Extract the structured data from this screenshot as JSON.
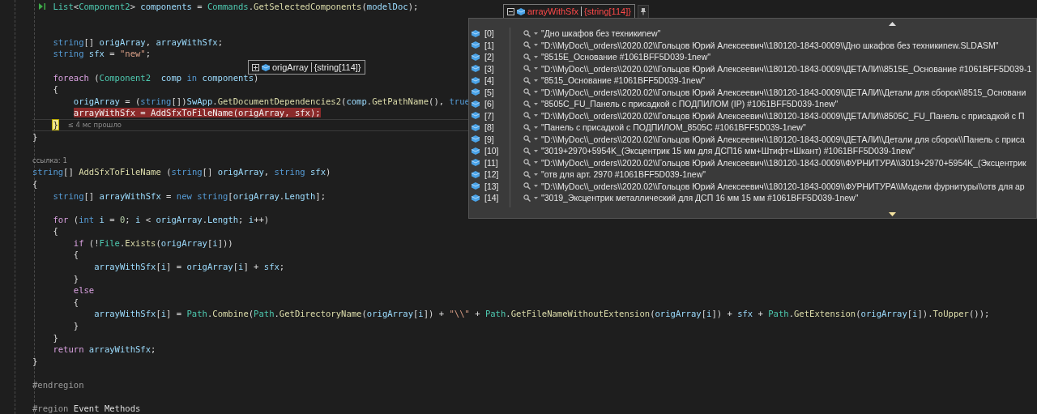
{
  "editor": {
    "lines": [
      {
        "kind": "block",
        "children": [
          {
            "kind": "code",
            "gutter_icon": true,
            "tokens": [
              {
                "text": "List",
                "kind": "type"
              },
              {
                "text": "<",
                "kind": "pl"
              },
              {
                "text": "Component2",
                "kind": "type"
              },
              {
                "text": "> ",
                "kind": "pl"
              },
              {
                "text": "components",
                "kind": "var"
              },
              {
                "text": " = ",
                "kind": "pl"
              },
              {
                "text": "Commands",
                "kind": "type"
              },
              {
                "text": ".",
                "kind": "pl"
              },
              {
                "text": "GetSelectedComponents",
                "kind": "fn"
              },
              {
                "text": "(",
                "kind": "pl"
              },
              {
                "text": "modelDoc",
                "kind": "var"
              },
              {
                "text": ");",
                "kind": "pl"
              }
            ]
          },
          {
            "kind": "blank"
          },
          {
            "kind": "blank"
          },
          {
            "kind": "code",
            "tokens": [
              {
                "text": "string",
                "kind": "kw"
              },
              {
                "text": "[] ",
                "kind": "pl"
              },
              {
                "text": "origArray",
                "kind": "var"
              },
              {
                "text": ", ",
                "kind": "pl"
              },
              {
                "text": "arrayWithSfx",
                "kind": "var"
              },
              {
                "text": ";",
                "kind": "pl"
              }
            ]
          },
          {
            "kind": "code",
            "tokens": [
              {
                "text": "string",
                "kind": "kw"
              },
              {
                "text": " sfx",
                "kind": "var"
              },
              {
                "text": " = ",
                "kind": "pl"
              },
              {
                "text": "\"new\"",
                "kind": "str"
              },
              {
                "text": ";",
                "kind": "pl"
              }
            ]
          },
          {
            "kind": "blank"
          },
          {
            "kind": "code",
            "tokens": [
              {
                "text": "foreach",
                "kind": "ctl"
              },
              {
                "text": " (",
                "kind": "pl"
              },
              {
                "text": "Component2",
                "kind": "type"
              },
              {
                "text": "  comp",
                "kind": "var"
              },
              {
                "text": " in ",
                "kind": "kw"
              },
              {
                "text": "components",
                "kind": "var"
              },
              {
                "text": ")",
                "kind": "pl"
              }
            ]
          },
          {
            "kind": "code",
            "tokens": [
              {
                "text": "{",
                "kind": "pl"
              }
            ],
            "children": [
              {
                "kind": "code",
                "tokens": [
                  {
                    "text": "origArray",
                    "kind": "var"
                  },
                  {
                    "text": " = (",
                    "kind": "pl"
                  },
                  {
                    "text": "string",
                    "kind": "kw"
                  },
                  {
                    "text": "[])",
                    "kind": "pl"
                  },
                  {
                    "text": "SwApp",
                    "kind": "var"
                  },
                  {
                    "text": ".",
                    "kind": "pl"
                  },
                  {
                    "text": "GetDocumentDependencies2",
                    "kind": "fn"
                  },
                  {
                    "text": "(",
                    "kind": "pl"
                  },
                  {
                    "text": "comp",
                    "kind": "var"
                  },
                  {
                    "text": ".",
                    "kind": "pl"
                  },
                  {
                    "text": "GetPathName",
                    "kind": "fn"
                  },
                  {
                    "text": "(), ",
                    "kind": "pl"
                  },
                  {
                    "text": "true",
                    "kind": "kw"
                  }
                ]
              },
              {
                "kind": "breakpoint",
                "tokens": [
                  {
                    "text": "arrayWithSfx",
                    "kind": "var"
                  },
                  {
                    "text": " = ",
                    "kind": "pl"
                  },
                  {
                    "text": "AddSfxToFileName",
                    "kind": "fn"
                  },
                  {
                    "text": "(",
                    "kind": "pl"
                  },
                  {
                    "text": "origArray",
                    "kind": "var"
                  },
                  {
                    "text": ", ",
                    "kind": "pl"
                  },
                  {
                    "text": "sfx",
                    "kind": "var"
                  },
                  {
                    "text": ");",
                    "kind": "pl"
                  }
                ]
              }
            ]
          },
          {
            "kind": "current",
            "perf_tip": "≤ 4 мс прошло",
            "tokens": [
              {
                "text": "}",
                "kind": "pl"
              }
            ]
          }
        ]
      },
      {
        "kind": "code",
        "tokens": [
          {
            "text": "}",
            "kind": "pl"
          }
        ]
      },
      {
        "kind": "blank"
      },
      {
        "kind": "lens",
        "tokens": [
          {
            "text": "ссылка: 1",
            "kind": "lens"
          }
        ]
      },
      {
        "kind": "code",
        "tokens": [
          {
            "text": "string",
            "kind": "kw"
          },
          {
            "text": "[] ",
            "kind": "pl"
          },
          {
            "text": "AddSfxToFileName",
            "kind": "fn"
          },
          {
            "text": " (",
            "kind": "pl"
          },
          {
            "text": "string",
            "kind": "kw"
          },
          {
            "text": "[] ",
            "kind": "pl"
          },
          {
            "text": "origArray",
            "kind": "var"
          },
          {
            "text": ", ",
            "kind": "pl"
          },
          {
            "text": "string",
            "kind": "kw"
          },
          {
            "text": " sfx",
            "kind": "var"
          },
          {
            "text": ")",
            "kind": "pl"
          }
        ]
      },
      {
        "kind": "code",
        "tokens": [
          {
            "text": "{",
            "kind": "pl"
          }
        ],
        "children": [
          {
            "kind": "code",
            "tokens": [
              {
                "text": "string",
                "kind": "kw"
              },
              {
                "text": "[] ",
                "kind": "pl"
              },
              {
                "text": "arrayWithSfx",
                "kind": "var"
              },
              {
                "text": " = ",
                "kind": "pl"
              },
              {
                "text": "new",
                "kind": "kw"
              },
              {
                "text": " string",
                "kind": "kw"
              },
              {
                "text": "[",
                "kind": "pl"
              },
              {
                "text": "origArray",
                "kind": "var"
              },
              {
                "text": ".",
                "kind": "pl"
              },
              {
                "text": "Length",
                "kind": "var"
              },
              {
                "text": "];",
                "kind": "pl"
              }
            ]
          },
          {
            "kind": "blank"
          },
          {
            "kind": "code",
            "tokens": [
              {
                "text": "for",
                "kind": "ctl"
              },
              {
                "text": " (",
                "kind": "pl"
              },
              {
                "text": "int",
                "kind": "kw"
              },
              {
                "text": " i",
                "kind": "var"
              },
              {
                "text": " = ",
                "kind": "pl"
              },
              {
                "text": "0",
                "kind": "num"
              },
              {
                "text": "; ",
                "kind": "pl"
              },
              {
                "text": "i",
                "kind": "var"
              },
              {
                "text": " < ",
                "kind": "pl"
              },
              {
                "text": "origArray",
                "kind": "var"
              },
              {
                "text": ".",
                "kind": "pl"
              },
              {
                "text": "Length",
                "kind": "var"
              },
              {
                "text": "; ",
                "kind": "pl"
              },
              {
                "text": "i",
                "kind": "var"
              },
              {
                "text": "++)",
                "kind": "pl"
              }
            ]
          },
          {
            "kind": "code",
            "tokens": [
              {
                "text": "{",
                "kind": "pl"
              }
            ],
            "children": [
              {
                "kind": "code",
                "tokens": [
                  {
                    "text": "if",
                    "kind": "ctl"
                  },
                  {
                    "text": " (!",
                    "kind": "pl"
                  },
                  {
                    "text": "File",
                    "kind": "type"
                  },
                  {
                    "text": ".",
                    "kind": "pl"
                  },
                  {
                    "text": "Exists",
                    "kind": "fn"
                  },
                  {
                    "text": "(",
                    "kind": "pl"
                  },
                  {
                    "text": "origArray",
                    "kind": "var"
                  },
                  {
                    "text": "[",
                    "kind": "pl"
                  },
                  {
                    "text": "i",
                    "kind": "var"
                  },
                  {
                    "text": "]))",
                    "kind": "pl"
                  }
                ]
              },
              {
                "kind": "code",
                "tokens": [
                  {
                    "text": "{",
                    "kind": "pl"
                  }
                ],
                "children": [
                  {
                    "kind": "code",
                    "tokens": [
                      {
                        "text": "arrayWithSfx",
                        "kind": "var"
                      },
                      {
                        "text": "[",
                        "kind": "pl"
                      },
                      {
                        "text": "i",
                        "kind": "var"
                      },
                      {
                        "text": "] = ",
                        "kind": "pl"
                      },
                      {
                        "text": "origArray",
                        "kind": "var"
                      },
                      {
                        "text": "[",
                        "kind": "pl"
                      },
                      {
                        "text": "i",
                        "kind": "var"
                      },
                      {
                        "text": "] + ",
                        "kind": "pl"
                      },
                      {
                        "text": "sfx",
                        "kind": "var"
                      },
                      {
                        "text": ";",
                        "kind": "pl"
                      }
                    ]
                  }
                ]
              },
              {
                "kind": "code",
                "tokens": [
                  {
                    "text": "}",
                    "kind": "pl"
                  }
                ]
              },
              {
                "kind": "code",
                "tokens": [
                  {
                    "text": "else",
                    "kind": "ctl"
                  }
                ]
              },
              {
                "kind": "code",
                "tokens": [
                  {
                    "text": "{",
                    "kind": "pl"
                  }
                ],
                "children": [
                  {
                    "kind": "code",
                    "tokens": [
                      {
                        "text": "arrayWithSfx",
                        "kind": "var"
                      },
                      {
                        "text": "[",
                        "kind": "pl"
                      },
                      {
                        "text": "i",
                        "kind": "var"
                      },
                      {
                        "text": "] = ",
                        "kind": "pl"
                      },
                      {
                        "text": "Path",
                        "kind": "type"
                      },
                      {
                        "text": ".",
                        "kind": "pl"
                      },
                      {
                        "text": "Combine",
                        "kind": "fn"
                      },
                      {
                        "text": "(",
                        "kind": "pl"
                      },
                      {
                        "text": "Path",
                        "kind": "type"
                      },
                      {
                        "text": ".",
                        "kind": "pl"
                      },
                      {
                        "text": "GetDirectoryName",
                        "kind": "fn"
                      },
                      {
                        "text": "(",
                        "kind": "pl"
                      },
                      {
                        "text": "origArray",
                        "kind": "var"
                      },
                      {
                        "text": "[",
                        "kind": "pl"
                      },
                      {
                        "text": "i",
                        "kind": "var"
                      },
                      {
                        "text": "]) + ",
                        "kind": "pl"
                      },
                      {
                        "text": "\"\\\\\"",
                        "kind": "str"
                      },
                      {
                        "text": " + ",
                        "kind": "pl"
                      },
                      {
                        "text": "Path",
                        "kind": "type"
                      },
                      {
                        "text": ".",
                        "kind": "pl"
                      },
                      {
                        "text": "GetFileNameWithoutExtension",
                        "kind": "fn"
                      },
                      {
                        "text": "(",
                        "kind": "pl"
                      },
                      {
                        "text": "origArray",
                        "kind": "var"
                      },
                      {
                        "text": "[",
                        "kind": "pl"
                      },
                      {
                        "text": "i",
                        "kind": "var"
                      },
                      {
                        "text": "]) + ",
                        "kind": "pl"
                      },
                      {
                        "text": "sfx",
                        "kind": "var"
                      },
                      {
                        "text": " + ",
                        "kind": "pl"
                      },
                      {
                        "text": "Path",
                        "kind": "type"
                      },
                      {
                        "text": ".",
                        "kind": "pl"
                      },
                      {
                        "text": "GetExtension",
                        "kind": "fn"
                      },
                      {
                        "text": "(",
                        "kind": "pl"
                      },
                      {
                        "text": "origArray",
                        "kind": "var"
                      },
                      {
                        "text": "[",
                        "kind": "pl"
                      },
                      {
                        "text": "i",
                        "kind": "var"
                      },
                      {
                        "text": "]).",
                        "kind": "pl"
                      },
                      {
                        "text": "ToUpper",
                        "kind": "fn"
                      },
                      {
                        "text": "());",
                        "kind": "pl"
                      }
                    ]
                  }
                ]
              },
              {
                "kind": "code",
                "tokens": [
                  {
                    "text": "}",
                    "kind": "pl"
                  }
                ]
              }
            ]
          },
          {
            "kind": "code",
            "tokens": [
              {
                "text": "}",
                "kind": "pl"
              }
            ]
          },
          {
            "kind": "code",
            "tokens": [
              {
                "text": "return",
                "kind": "ctl"
              },
              {
                "text": " arrayWithSfx",
                "kind": "var"
              },
              {
                "text": ";",
                "kind": "pl"
              }
            ]
          }
        ]
      },
      {
        "kind": "code",
        "tokens": [
          {
            "text": "}",
            "kind": "pl"
          }
        ]
      },
      {
        "kind": "blank"
      },
      {
        "kind": "code",
        "tokens": [
          {
            "text": "#endregion",
            "kind": "pre"
          }
        ]
      },
      {
        "kind": "blank"
      },
      {
        "kind": "code",
        "tokens": [
          {
            "text": "#region",
            "kind": "pre"
          },
          {
            "text": " Event Methods",
            "kind": "pl"
          }
        ]
      }
    ]
  },
  "datatips": [
    {
      "name": "origArray",
      "value": "{string[114]}",
      "expanded": false,
      "changed": false
    },
    {
      "name": "arrayWithSfx",
      "value": "{string[114]}",
      "expanded": true,
      "changed": true,
      "items": [
        {
          "index": "[0]",
          "value": "\"Дно шкафов без техникиnew\""
        },
        {
          "index": "[1]",
          "value": "\"D:\\\\MyDoc\\\\_orders\\\\2020.02\\\\Гольцов Юрий Алексеевич\\\\180120-1843-0009\\\\Дно шкафов без техникиnew.SLDASM\""
        },
        {
          "index": "[2]",
          "value": "\"8515E_Основание #1061BFF5D039-1new\""
        },
        {
          "index": "[3]",
          "value": "\"D:\\\\MyDoc\\\\_orders\\\\2020.02\\\\Гольцов Юрий Алексеевич\\\\180120-1843-0009\\\\ДЕТАЛИ\\\\8515E_Основание #1061BFF5D039-1"
        },
        {
          "index": "[4]",
          "value": "\"8515_Основание #1061BFF5D039-1new\""
        },
        {
          "index": "[5]",
          "value": "\"D:\\\\MyDoc\\\\_orders\\\\2020.02\\\\Гольцов Юрий Алексеевич\\\\180120-1843-0009\\\\ДЕТАЛИ\\\\Детали для сборок\\\\8515_Основани"
        },
        {
          "index": "[6]",
          "value": "\"8505C_FU_Панель с присадкой с ПОДПИЛОМ (IP) #1061BFF5D039-1new\""
        },
        {
          "index": "[7]",
          "value": "\"D:\\\\MyDoc\\\\_orders\\\\2020.02\\\\Гольцов Юрий Алексеевич\\\\180120-1843-0009\\\\ДЕТАЛИ\\\\8505C_FU_Панель с присадкой с П"
        },
        {
          "index": "[8]",
          "value": "\"Панель с присадкой с ПОДПИЛОМ_8505C #1061BFF5D039-1new\""
        },
        {
          "index": "[9]",
          "value": "\"D:\\\\MyDoc\\\\_orders\\\\2020.02\\\\Гольцов Юрий Алексеевич\\\\180120-1843-0009\\\\ДЕТАЛИ\\\\Детали для сборок\\\\Панель с приса"
        },
        {
          "index": "[10]",
          "value": "\"3019+2970+5954K_(Эксцентрик 15 мм для ДСП16 мм+Штифт+Шкант) #1061BFF5D039-1new\""
        },
        {
          "index": "[11]",
          "value": "\"D:\\\\MyDoc\\\\_orders\\\\2020.02\\\\Гольцов Юрий Алексеевич\\\\180120-1843-0009\\\\ФУРНИТУРА\\\\3019+2970+5954K_(Эксцентрик"
        },
        {
          "index": "[12]",
          "value": "\"отв для арт. 2970 #1061BFF5D039-1new\""
        },
        {
          "index": "[13]",
          "value": "\"D:\\\\MyDoc\\\\_orders\\\\2020.02\\\\Гольцов Юрий Алексеевич\\\\180120-1843-0009\\\\ФУРНИТУРА\\\\Модели фурнитуры\\\\отв для ар"
        },
        {
          "index": "[14]",
          "value": "\"3019_Эксцентрик металлический для ДСП 16 мм 15 мм #1061BFF5D039-1new\""
        }
      ]
    }
  ]
}
